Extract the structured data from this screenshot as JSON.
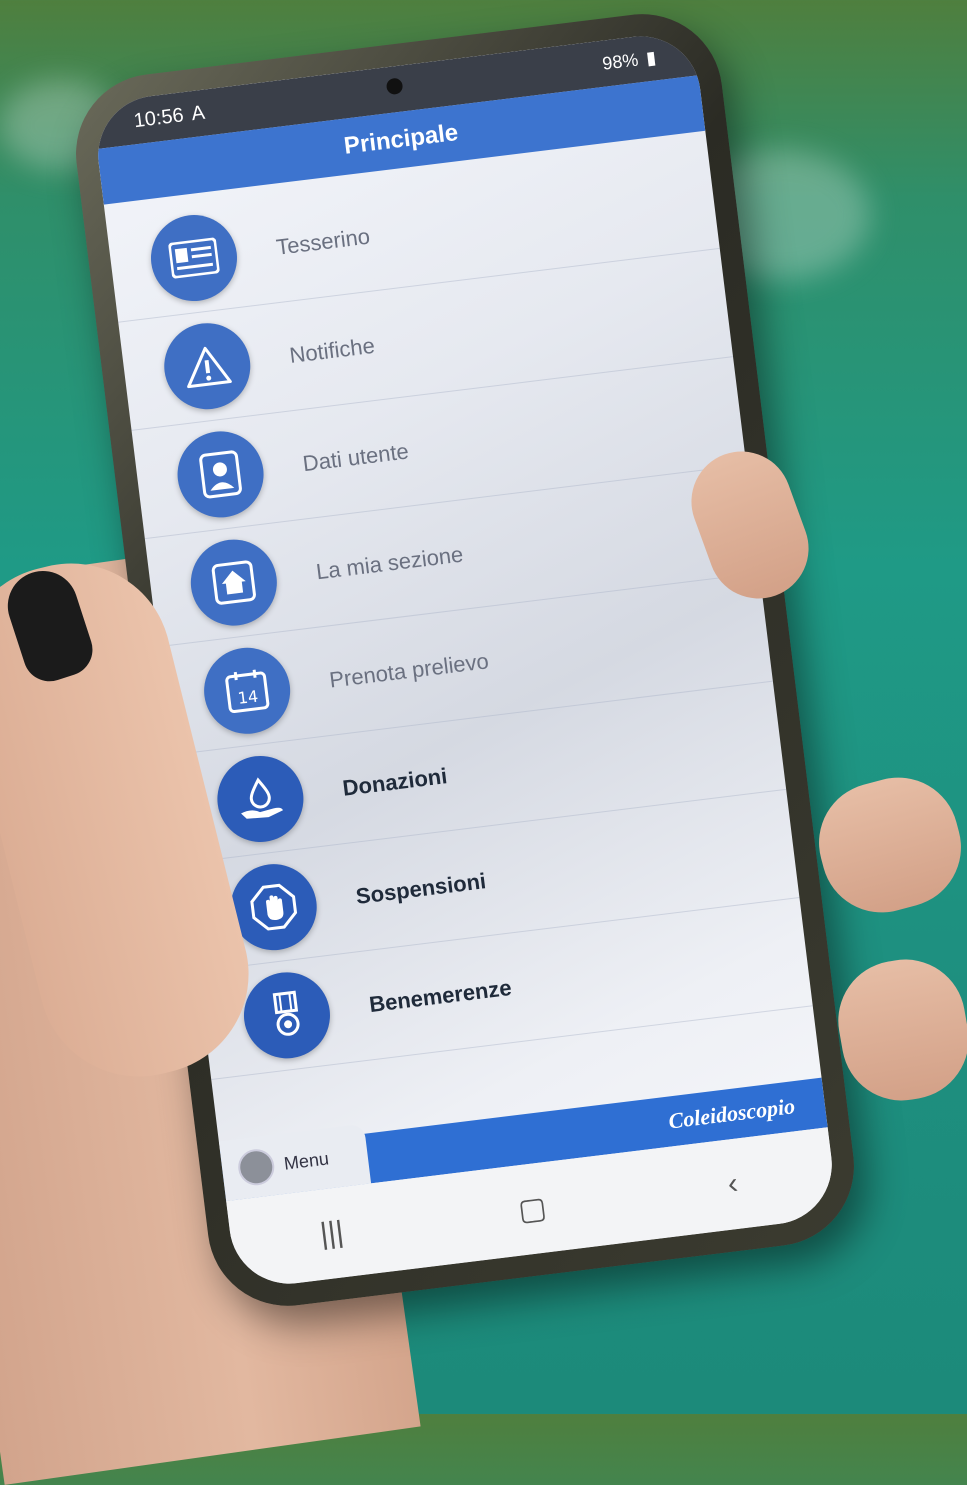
{
  "status_bar": {
    "time": "10:56",
    "left_icons": "A",
    "battery": "98%"
  },
  "app_bar": {
    "title": "Principale"
  },
  "menu_items": [
    {
      "label": "Tesserino",
      "icon": "id-card-icon"
    },
    {
      "label": "Notifiche",
      "icon": "warning-icon"
    },
    {
      "label": "Dati utente",
      "icon": "user-profile-icon"
    },
    {
      "label": "La mia sezione",
      "icon": "home-icon"
    },
    {
      "label": "Prenota prelievo",
      "icon": "calendar-icon"
    },
    {
      "label": "Donazioni",
      "icon": "blood-drop-hand-icon"
    },
    {
      "label": "Sospensioni",
      "icon": "stop-hand-icon"
    },
    {
      "label": "Benemerenze",
      "icon": "medal-icon"
    }
  ],
  "bottom_bar": {
    "brand": "Coleidoscopio",
    "menu_label": "Menu"
  },
  "colors": {
    "app_bar": "#3d74cf",
    "icon_circle": "#3f6fc4",
    "bottom_bar": "#2f6fd3"
  }
}
